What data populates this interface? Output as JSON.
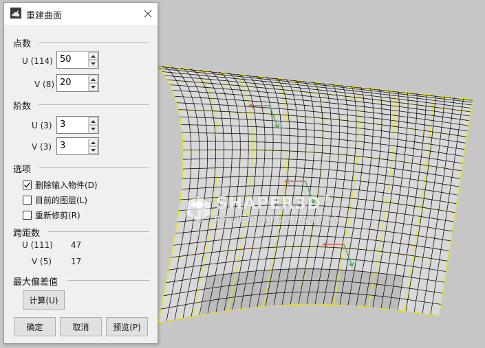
{
  "dialog": {
    "title": "重建曲面",
    "sections": {
      "points": "点数",
      "degree": "阶数",
      "options": "选项",
      "span": "跨距数",
      "max_deviation": "最大偏差值"
    },
    "point_count": {
      "u_label": "U (114)",
      "u_value": "50",
      "v_label": "V (8)",
      "v_value": "20"
    },
    "degree": {
      "u_label": "U (3)",
      "u_value": "3",
      "v_label": "V (3)",
      "v_value": "3"
    },
    "options": [
      {
        "label": "删除输入物件(D)",
        "checked": true
      },
      {
        "label": "目前的图层(L)",
        "checked": false
      },
      {
        "label": "重新修剪(R)",
        "checked": false
      }
    ],
    "span": {
      "u_label": "U (111)",
      "u_value": "47",
      "v_label": "V (5)",
      "v_value": "17"
    },
    "buttons": {
      "calculate": "计算(U)",
      "ok": "确定",
      "cancel": "取消",
      "preview": "预览(P)"
    }
  },
  "watermark": {
    "brand": "SHAPER3D",
    "registered": "®",
    "subtitle": "Rhino(犀牛)中国技术支持&推广中心"
  },
  "colors": {
    "surface_fill": "#d9d9d9",
    "mesh_line": "#111111",
    "isocurve": "#e8e23a",
    "viewport_bg": "#c6c6c6",
    "dialog_bg": "#f0f0f0"
  }
}
